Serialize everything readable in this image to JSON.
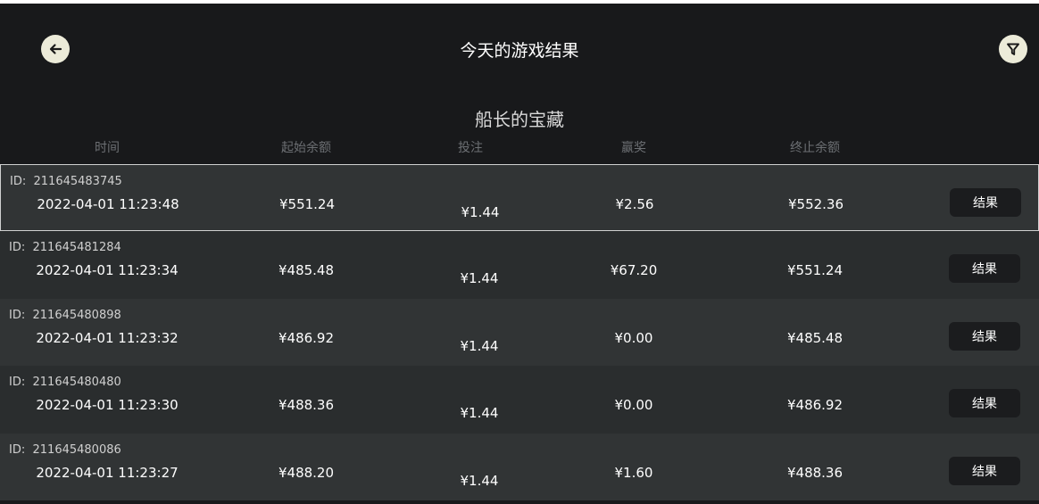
{
  "header": {
    "title": "今天的游戏结果",
    "back_icon": "arrow-left-icon",
    "filter_icon": "funnel-icon"
  },
  "game_name": "船长的宝藏",
  "columns": [
    "时间",
    "起始余额",
    "投注",
    "赢奖",
    "终止余额"
  ],
  "rows": [
    {
      "id_label": "ID:",
      "id": "211645483745",
      "time": "2022-04-01 11:23:48",
      "start_balance": "¥551.24",
      "bet": "¥1.44",
      "win": "¥2.56",
      "end_balance": "¥552.36",
      "result_label": "结果"
    },
    {
      "id_label": "ID:",
      "id": "211645481284",
      "time": "2022-04-01 11:23:34",
      "start_balance": "¥485.48",
      "bet": "¥1.44",
      "win": "¥67.20",
      "end_balance": "¥551.24",
      "result_label": "结果"
    },
    {
      "id_label": "ID:",
      "id": "211645480898",
      "time": "2022-04-01 11:23:32",
      "start_balance": "¥486.92",
      "bet": "¥1.44",
      "win": "¥0.00",
      "end_balance": "¥485.48",
      "result_label": "结果"
    },
    {
      "id_label": "ID:",
      "id": "211645480480",
      "time": "2022-04-01 11:23:30",
      "start_balance": "¥488.36",
      "bet": "¥1.44",
      "win": "¥0.00",
      "end_balance": "¥486.92",
      "result_label": "结果"
    },
    {
      "id_label": "ID:",
      "id": "211645480086",
      "time": "2022-04-01 11:23:27",
      "start_balance": "¥488.20",
      "bet": "¥1.44",
      "win": "¥1.60",
      "end_balance": "¥488.36",
      "result_label": "结果"
    }
  ],
  "colors": {
    "background": "#18191b",
    "row_odd": "#313435",
    "row_even": "#2a2d2e",
    "icon_button": "#ecebd9",
    "result_button": "#1b1c1e"
  }
}
